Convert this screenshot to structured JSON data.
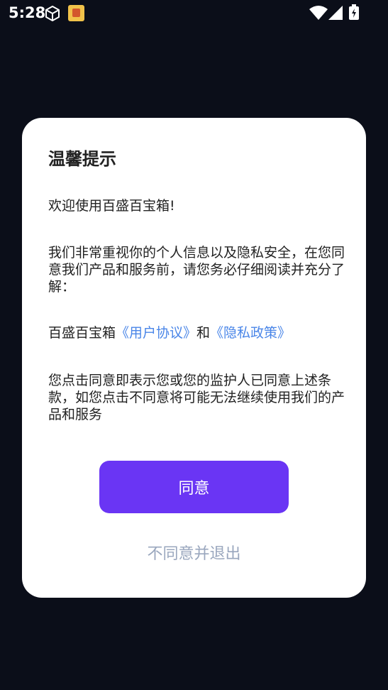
{
  "status_bar": {
    "time": "5:28",
    "icons": [
      "cube-icon",
      "app-notification-icon",
      "wifi-icon",
      "cellular-signal-icon",
      "battery-charging-icon"
    ]
  },
  "dialog": {
    "title": "温馨提示",
    "welcome": "欢迎使用百盛百宝箱!",
    "importance": "我们非常重视你的个人信息以及隐私安全，在您同意我们产品和服务前，请您务必仔细阅读并充分了解：",
    "links_prefix": "百盛百宝箱",
    "user_agreement": "《用户协议》",
    "links_and": "和",
    "privacy_policy": "《隐私政策》",
    "consent": "您点击同意即表示您或您的监护人已同意上述条款，如您点击不同意将可能无法继续使用我们的产品和服务",
    "agree_label": "同意",
    "disagree_label": "不同意并退出"
  },
  "colors": {
    "background": "#0b0e19",
    "accent": "#6a35f4",
    "link": "#4a86e8",
    "muted": "#9aa7be"
  }
}
